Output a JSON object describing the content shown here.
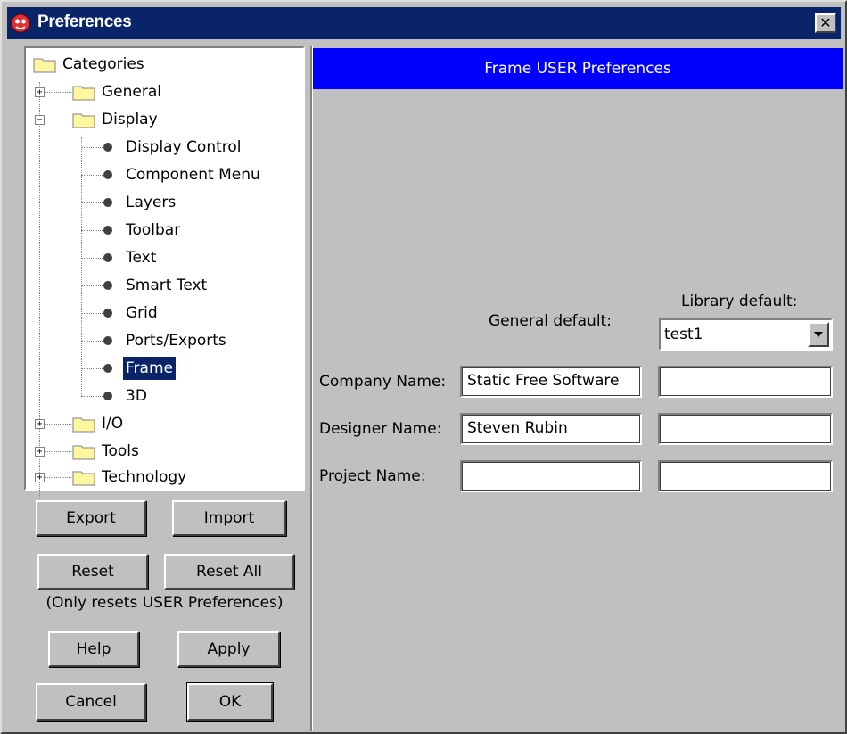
{
  "window": {
    "title": "Preferences",
    "close_label": "✕"
  },
  "tree": {
    "root": "Categories",
    "items": [
      {
        "label": "General"
      },
      {
        "label": "Display"
      },
      {
        "label": "Display Control"
      },
      {
        "label": "Component Menu"
      },
      {
        "label": "Layers"
      },
      {
        "label": "Toolbar"
      },
      {
        "label": "Text"
      },
      {
        "label": "Smart Text"
      },
      {
        "label": "Grid"
      },
      {
        "label": "Ports/Exports"
      },
      {
        "label": "Frame"
      },
      {
        "label": "3D"
      },
      {
        "label": "I/O"
      },
      {
        "label": "Tools"
      },
      {
        "label": "Technology"
      }
    ],
    "expanded_marker": "−",
    "collapsed_marker": "+"
  },
  "buttons": {
    "export": "Export",
    "import": "Import",
    "reset": "Reset",
    "reset_all": "Reset All",
    "reset_note": "(Only resets USER Preferences)",
    "help": "Help",
    "apply": "Apply",
    "cancel": "Cancel",
    "ok": "OK"
  },
  "panel": {
    "header": "Frame USER Preferences",
    "general_default_label": "General default:",
    "library_default_label": "Library default:",
    "library_select_value": "test1",
    "rows": [
      {
        "label": "Company Name:",
        "general": "Static Free Software",
        "library": ""
      },
      {
        "label": "Designer Name:",
        "general": "Steven Rubin",
        "library": ""
      },
      {
        "label": "Project Name:",
        "general": "",
        "library": ""
      }
    ]
  }
}
